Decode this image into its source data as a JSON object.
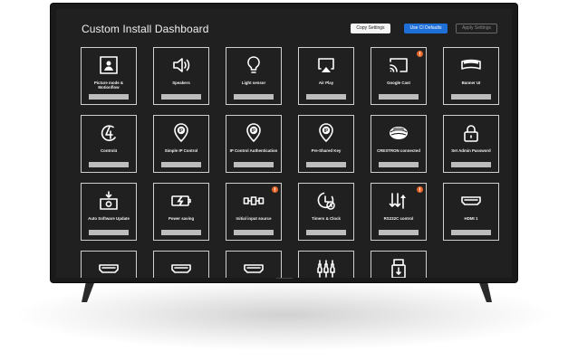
{
  "dashboard": {
    "title": "Custom Install Dashboard",
    "buttons": {
      "copy": "Copy Settings",
      "cs_defaults": "Use CI Defaults",
      "apply": "Apply Settings"
    },
    "accent_color": "#1f6fd8",
    "badge_color": "#e8692b"
  },
  "tiles": [
    {
      "label": "Picture mode & Motionflow",
      "icon": "picture-frame-icon",
      "badge": false
    },
    {
      "label": "Speakers",
      "icon": "speaker-icon",
      "badge": false
    },
    {
      "label": "Light sensor",
      "icon": "lightbulb-icon",
      "badge": false
    },
    {
      "label": "Air Play",
      "icon": "airplay-icon",
      "badge": false
    },
    {
      "label": "Google Cast",
      "icon": "cast-icon",
      "badge": true
    },
    {
      "label": "Banner UI",
      "icon": "banner-icon",
      "badge": false
    },
    {
      "label": "Control4",
      "icon": "control4-icon",
      "badge": false
    },
    {
      "label": "Simple IP Control",
      "icon": "ip-pin-icon",
      "badge": false
    },
    {
      "label": "IP Control Authentication",
      "icon": "ip-pin-icon",
      "badge": false
    },
    {
      "label": "Pre-Shared Key",
      "icon": "ip-pin-icon",
      "badge": false
    },
    {
      "label": "CRESTRON connected",
      "icon": "crestron-icon",
      "badge": false
    },
    {
      "label": "Set Admin Password",
      "icon": "padlock-icon",
      "badge": false
    },
    {
      "label": "Auto Software Update",
      "icon": "software-update-icon",
      "badge": false
    },
    {
      "label": "Power saving",
      "icon": "battery-charging-icon",
      "badge": false
    },
    {
      "label": "Initial input source",
      "icon": "input-source-icon",
      "badge": true
    },
    {
      "label": "Timers & Clock",
      "icon": "timer-clock-icon",
      "badge": false
    },
    {
      "label": "RS232C control",
      "icon": "rs232c-arrows-icon",
      "badge": true
    },
    {
      "label": "HDMI 1",
      "icon": "hdmi-icon",
      "badge": false
    },
    {
      "label": "",
      "icon": "hdmi-icon",
      "badge": false
    },
    {
      "label": "",
      "icon": "hdmi-icon",
      "badge": false
    },
    {
      "label": "",
      "icon": "hdmi-icon",
      "badge": false
    },
    {
      "label": "",
      "icon": "composite-rca-icon",
      "badge": false
    },
    {
      "label": "",
      "icon": "usb-drive-icon",
      "badge": false
    }
  ]
}
